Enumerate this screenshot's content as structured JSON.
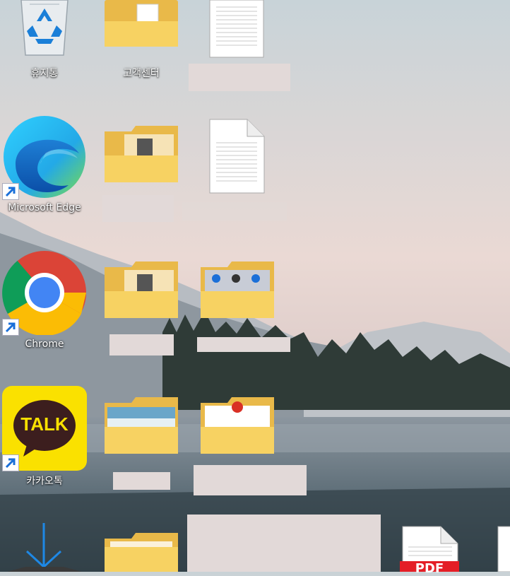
{
  "desktop": {
    "icons": [
      {
        "name": "recycle-bin",
        "label": "휴지통"
      },
      {
        "name": "folder-customer-center",
        "label": "고객센터"
      },
      {
        "name": "microsoft-edge",
        "label": "Microsoft Edge"
      },
      {
        "name": "chrome",
        "label": "Chrome"
      },
      {
        "name": "kakaotalk",
        "label": "카카오톡"
      }
    ],
    "kakao_badge_text": "TALK",
    "pdf_badge_text": "PDF"
  }
}
